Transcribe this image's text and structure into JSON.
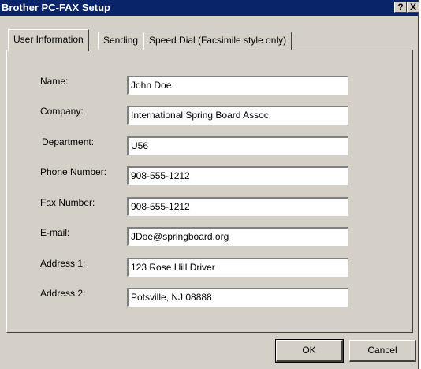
{
  "window": {
    "title": "Brother PC-FAX Setup",
    "help_glyph": "?",
    "close_glyph": "X"
  },
  "tabs": [
    {
      "label": "User Information",
      "active": true
    },
    {
      "label": "Sending",
      "active": false
    },
    {
      "label": "Speed Dial (Facsimile style only)",
      "active": false
    }
  ],
  "fields": [
    {
      "label": "Name:",
      "value": "John Doe"
    },
    {
      "label": "Company:",
      "value": "International Spring Board Assoc."
    },
    {
      "label": "Department:",
      "value": "U56"
    },
    {
      "label": "Phone Number:",
      "value": "908-555-1212"
    },
    {
      "label": "Fax Number:",
      "value": "908-555-1212"
    },
    {
      "label": "E-mail:",
      "value": "JDoe@springboard.org"
    },
    {
      "label": "Address 1:",
      "value": "123 Rose Hill Driver"
    },
    {
      "label": "Address 2:",
      "value": "Potsville, NJ 08888"
    }
  ],
  "buttons": {
    "ok": "OK",
    "cancel": "Cancel"
  }
}
